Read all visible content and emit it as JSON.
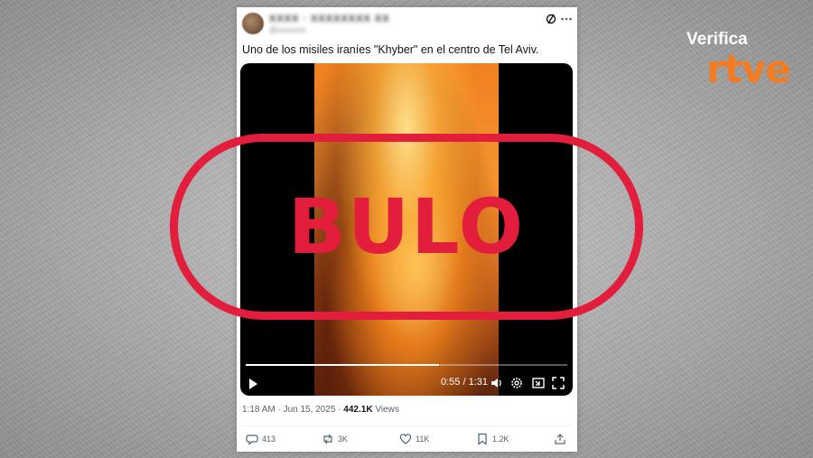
{
  "tweet": {
    "author_name": "XXXX · XXXXXXXX XX",
    "author_handle": "@xxxxxxx",
    "text": "Uno de los misiles iraníes \"Khyber\" en el centro de Tel Aviv.",
    "timestamp": "1:18 AM · Jun 15, 2025 ·",
    "views_count": "442.1K",
    "views_label": "Views",
    "video": {
      "time": "0:55 / 1:31",
      "progress": 0.6
    },
    "actions": {
      "replies": "413",
      "reposts": "3K",
      "likes": "11K",
      "bookmarks": "1.2K"
    }
  },
  "overlay": {
    "stamp_text": "BULO",
    "stamp_color": "#e31d3c"
  },
  "branding": {
    "verifica": "Verifica",
    "rtve": "rtve",
    "rtve_color": "#f47b20"
  }
}
